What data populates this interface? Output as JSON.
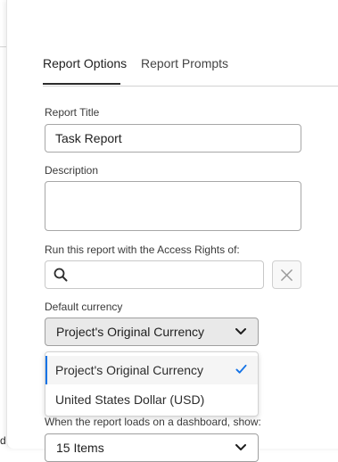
{
  "underlay": {
    "fragment_text": "d"
  },
  "tabs": [
    {
      "label": "Report Options",
      "active": true
    },
    {
      "label": "Report Prompts",
      "active": false
    }
  ],
  "report_title": {
    "label": "Report Title",
    "value": "Task Report"
  },
  "description": {
    "label": "Description",
    "value": ""
  },
  "access_rights": {
    "label": "Run this report with the Access Rights of:",
    "value": ""
  },
  "default_currency": {
    "label": "Default currency",
    "selected": "Project's Original Currency",
    "options": [
      {
        "label": "Project's Original Currency",
        "selected": true
      },
      {
        "label": "United States Dollar (USD)",
        "selected": false
      }
    ]
  },
  "dashboard_items": {
    "label": "When the report loads on a dashboard, show:",
    "selected": "15 Items"
  },
  "colors": {
    "accent": "#1473e6",
    "text": "#2c2c2c",
    "field_border": "#a7a7a7",
    "select_bg": "#e9e9e9"
  }
}
